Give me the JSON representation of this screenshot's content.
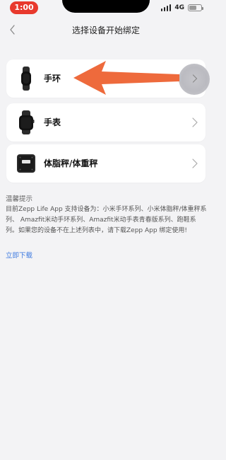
{
  "status_bar": {
    "time": "1:00",
    "network": "4G",
    "battery_level": 0.6
  },
  "nav": {
    "title": "选择设备开始绑定",
    "back_icon": "chevron-left-icon"
  },
  "devices": [
    {
      "label": "手环",
      "icon": "band-icon"
    },
    {
      "label": "手表",
      "icon": "watch-icon"
    },
    {
      "label": "体脂秤/体重秤",
      "icon": "scale-icon"
    }
  ],
  "tips": {
    "title": "温馨提示",
    "body": "目前Zepp Life App 支持设备为：小米手环系列、小米体脂秤/体重秤系列、 Amazfit米动手环系列、Amazfit米动手表青春版系列、跑鞋系列。如果您的设备不在上述列表中，请下载Zepp App 绑定使用!",
    "link": "立即下载"
  },
  "colors": {
    "accent": "#3d7ae0",
    "arrow": "#ee6a3c",
    "time_pill": "#e8392d",
    "background": "#f3f3f5"
  }
}
